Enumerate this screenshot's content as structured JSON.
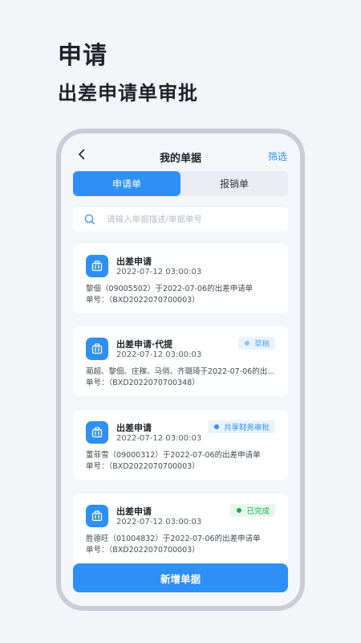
{
  "hero": {
    "title": "申请",
    "subtitle": "出差申请单审批"
  },
  "nav": {
    "title": "我的单据",
    "filter_label": "筛选"
  },
  "tabs": [
    {
      "label": "申请单",
      "active": true
    },
    {
      "label": "报销单",
      "active": false
    }
  ],
  "search": {
    "placeholder": "请输入单据描述/单据单号",
    "value": ""
  },
  "cards": [
    {
      "title": "出差申请",
      "time": "2022-07-12 03:00:03",
      "desc": "黎佃（09005502）于2022-07-06的出差申请单",
      "no": "单号：（BXD2022070700003）",
      "badge": null
    },
    {
      "title": "出差申请·代提",
      "time": "2022-07-12 03:00:03",
      "desc": "蔺超、黎佃、庄稼、马俏、齐璐琦于2022-07-06的出...",
      "no": "单号：（BXD2022070700348）",
      "badge": {
        "label": "草稿",
        "status": "draft",
        "color": "#5aa6f3"
      }
    },
    {
      "title": "出差申请",
      "time": "2022-07-12 03:00:03",
      "desc": "董菲雪（09000312）于2022-07-06的出差申请单",
      "no": "单号：（BXD2022070700003）",
      "badge": {
        "label": "共享财务审批",
        "status": "shared-finance",
        "color": "#2e8ff5"
      }
    },
    {
      "title": "出差申请",
      "time": "2022-07-12 03:00:03",
      "desc": "胜德旺（01004832）于2022-07-06的出差申请单",
      "no": "单号：（BXD2022070700003）",
      "badge": {
        "label": "已完成",
        "status": "done",
        "color": "#23a94b"
      }
    }
  ],
  "add_button_label": "新增单据",
  "icons": {
    "back": "chevron-left-icon",
    "search": "search-icon",
    "card": "briefcase-icon"
  },
  "colors": {
    "accent": "#2e8ff5",
    "done": "#23a94b",
    "background": "#f3f5f9"
  }
}
